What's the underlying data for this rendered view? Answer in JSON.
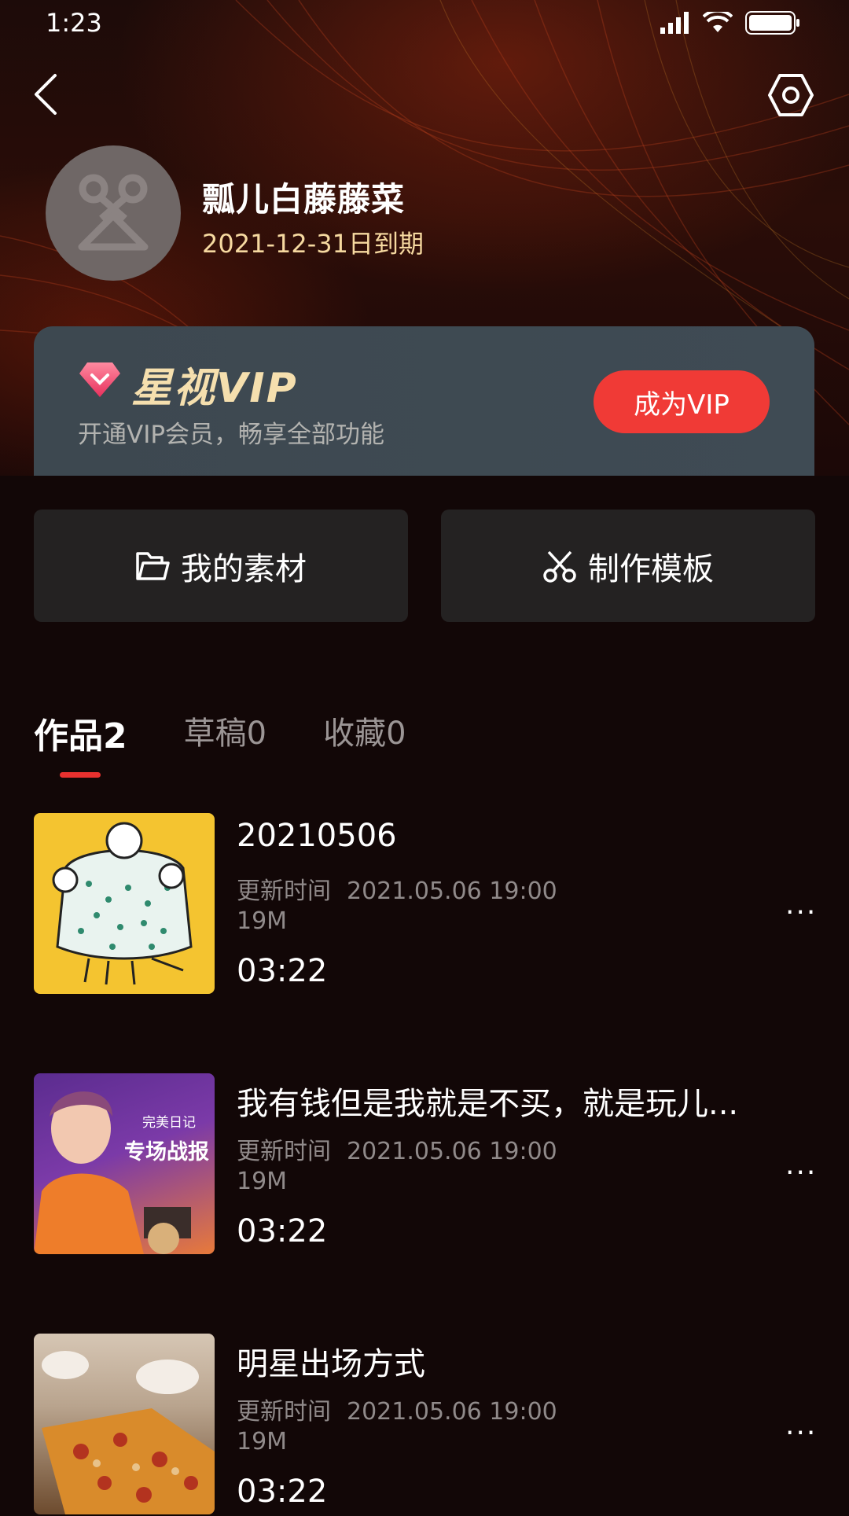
{
  "status_bar": {
    "time": "1:23"
  },
  "profile": {
    "username": "瓢儿白藤藤菜",
    "expiry": "2021-12-31日到期"
  },
  "vip": {
    "title": "星视VIP",
    "subtitle": "开通VIP会员，畅享全部功能",
    "button": "成为VIP",
    "accent": "#f03a36",
    "title_color": "#f5dfae"
  },
  "actions": {
    "materials": "我的素材",
    "templates": "制作模板"
  },
  "tabs": [
    {
      "label": "作品2",
      "active": true
    },
    {
      "label": "草稿0",
      "active": false
    },
    {
      "label": "收藏0",
      "active": false
    }
  ],
  "works": [
    {
      "title": "20210506",
      "update_label": "更新时间",
      "update_time": "2021.05.06 19:00",
      "size": "19M",
      "duration": "03:22",
      "more": "···"
    },
    {
      "title": "我有钱但是我就是不买，就是玩儿...",
      "update_label": "更新时间",
      "update_time": "2021.05.06 19:00",
      "size": "19M",
      "duration": "03:22",
      "more": "···",
      "thumb_text_top": "完美日记",
      "thumb_text_main": "专场战报"
    },
    {
      "title": "明星出场方式",
      "update_label": "更新时间",
      "update_time": "2021.05.06 19:00",
      "size": "19M",
      "duration": "03:22",
      "more": "···"
    }
  ]
}
